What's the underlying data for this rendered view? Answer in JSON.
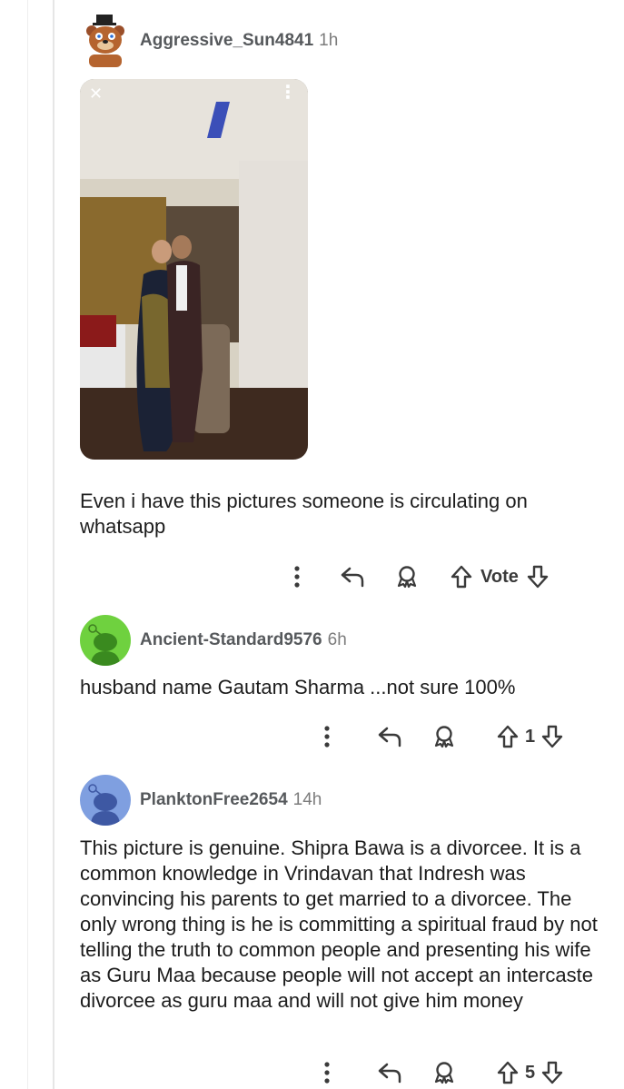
{
  "comments": [
    {
      "username": "Aggressive_Sun4841",
      "age": "1h",
      "avatar_icon": "freddy-bear-avatar-icon",
      "text": "Even i have this pictures someone is circulating on whatsapp",
      "image_controls": {
        "close": "✕",
        "more": "⋮"
      },
      "vote_label": "Vote"
    },
    {
      "username": "Ancient-Standard9576",
      "age": "6h",
      "avatar_icon": "snoo-green-avatar-icon",
      "text": "husband name Gautam Sharma ...not sure 100%",
      "vote_count": "1"
    },
    {
      "username": "PlanktonFree2654",
      "age": "14h",
      "avatar_icon": "snoo-blue-avatar-icon",
      "text": "This picture is genuine. Shipra Bawa is a divorcee. It is a common knowledge in Vrindavan that Indresh was convincing his parents to get married to a divorcee. The only wrong thing is he is committing a spiritual fraud by not telling the truth to common people and presenting his wife as Guru Maa because people will not accept an intercaste divorcee as guru maa and will not give him money",
      "vote_count": "5"
    }
  ],
  "colors": {
    "green_avatar": "#6fd13f",
    "blue_avatar": "#7f9fe0",
    "meta_text": "#7c7c7c"
  }
}
